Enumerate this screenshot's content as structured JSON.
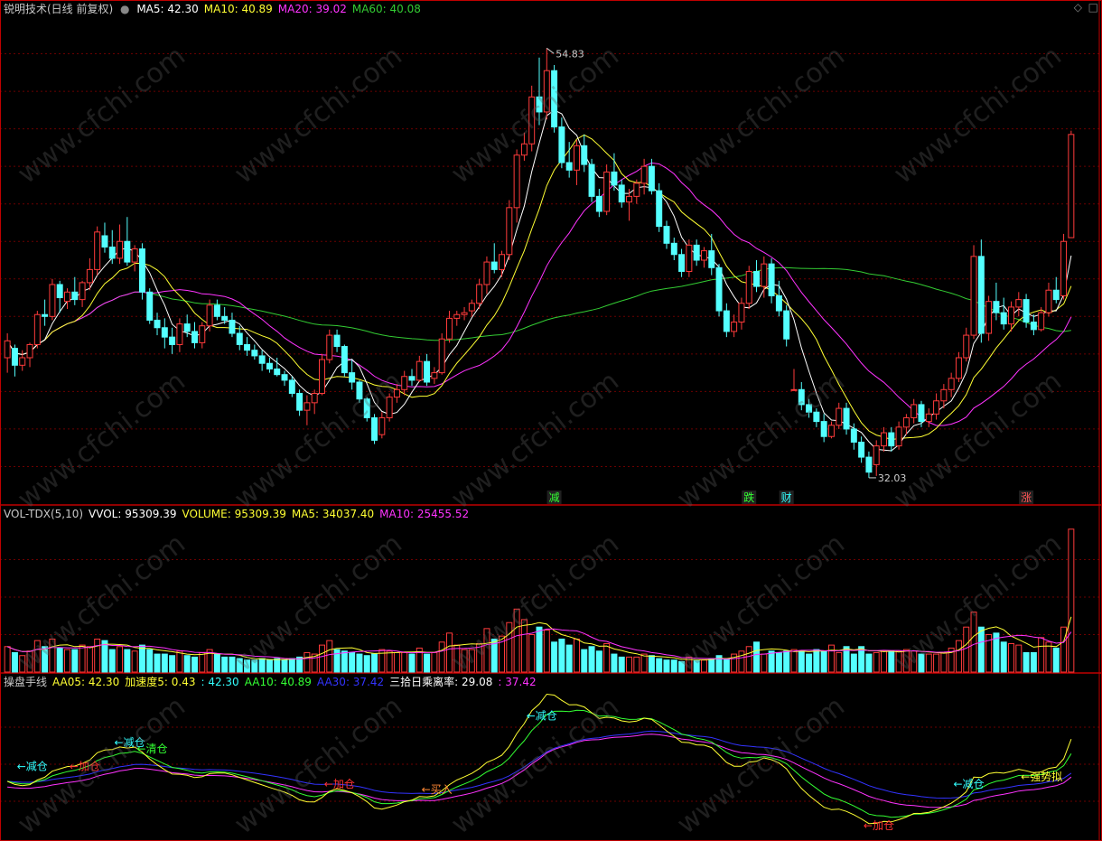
{
  "title": "锐明技术(日线 前复权)",
  "colors": {
    "up": "#ff3b3b",
    "down": "#54ffff",
    "ma5": "#ffffff",
    "ma10": "#ffff33",
    "ma20": "#ff33ff",
    "ma60": "#33cc33",
    "grid": "#6b0000",
    "border": "#c00000"
  },
  "main_header": [
    {
      "text": "MA5: 42.30",
      "color": "#ffffff"
    },
    {
      "text": "MA10: 40.89",
      "color": "#ffff33"
    },
    {
      "text": "MA20: 39.02",
      "color": "#ff33ff"
    },
    {
      "text": "MA60: 40.08",
      "color": "#33cc33"
    }
  ],
  "vol_header": [
    {
      "text": "VOL-TDX(5,10)",
      "color": "#c8c8c8"
    },
    {
      "text": "VVOL: 95309.39",
      "color": "#ffffff"
    },
    {
      "text": "VOLUME: 95309.39",
      "color": "#ffff33"
    },
    {
      "text": "MA5: 34037.40",
      "color": "#ffff33"
    },
    {
      "text": "MA10: 25455.52",
      "color": "#ff33ff"
    }
  ],
  "ind_header": [
    {
      "text": "操盘手线",
      "color": "#c8c8c8"
    },
    {
      "text": "AA05: 42.30",
      "color": "#ffff33"
    },
    {
      "text": "加速度5: 0.43",
      "color": "#ffff33"
    },
    {
      "text": ": 42.30",
      "color": "#33ffff"
    },
    {
      "text": "AA10: 40.89",
      "color": "#33ff33"
    },
    {
      "text": "AA30: 37.42",
      "color": "#3333ff"
    },
    {
      "text": "三拾日乘离率: 29.08",
      "color": "#ffffff"
    },
    {
      "text": ": 37.42",
      "color": "#ff33ff"
    }
  ],
  "price_labels": {
    "high": "54.83",
    "low": "32.03"
  },
  "markers": [
    {
      "text": "减",
      "color": "#33ff33",
      "bar": 73
    },
    {
      "text": "跌",
      "color": "#33ff33",
      "bar": 99
    },
    {
      "text": "财",
      "color": "#33ffff",
      "bar": 104
    },
    {
      "text": "涨",
      "color": "#ff5555",
      "bar": 136
    }
  ],
  "ind_labels": [
    {
      "text": "←减仓",
      "color": "#33ffff",
      "bar": 2,
      "val": 41.2
    },
    {
      "text": "←加仓",
      "color": "#ff3333",
      "bar": 9,
      "val": 41.2
    },
    {
      "text": "←减仓",
      "color": "#33ffff",
      "bar": 15,
      "val": 44.4
    },
    {
      "text": "←清仓",
      "color": "#33ff33",
      "bar": 18,
      "val": 43.6
    },
    {
      "text": "←加仓",
      "color": "#ff3333",
      "bar": 43,
      "val": 38.8
    },
    {
      "text": "←买入",
      "color": "#ff8833",
      "bar": 56,
      "val": 38.1
    },
    {
      "text": "←减仓",
      "color": "#33ffff",
      "bar": 70,
      "val": 48.0
    },
    {
      "text": "←加仓",
      "color": "#ff3333",
      "bar": 115,
      "val": 33.2
    },
    {
      "text": "←减仓",
      "color": "#33ffff",
      "bar": 127,
      "val": 38.8
    },
    {
      "text": "←强势拟",
      "color": "#ffff33",
      "bar": 136,
      "val": 39.8
    }
  ],
  "watermark": "www.cfchi.com",
  "chart_data": {
    "type": "candlestick",
    "ylim": [
      30.5,
      56.5
    ],
    "vol_ylim": [
      0,
      100000
    ],
    "ind_ylim": [
      31.5,
      51.5
    ],
    "ohlc": [
      [
        38.3,
        39.6,
        37.5,
        39.2
      ],
      [
        38.8,
        39.0,
        37.3,
        37.9
      ],
      [
        37.9,
        38.7,
        37.6,
        38.3
      ],
      [
        38.3,
        39.1,
        37.8,
        39.0
      ],
      [
        39.0,
        40.8,
        38.8,
        40.6
      ],
      [
        40.6,
        41.4,
        40.0,
        40.5
      ],
      [
        40.5,
        42.5,
        40.3,
        42.2
      ],
      [
        42.2,
        42.4,
        40.7,
        41.5
      ],
      [
        41.3,
        42.0,
        40.9,
        41.8
      ],
      [
        41.8,
        42.6,
        41.1,
        41.4
      ],
      [
        41.4,
        42.4,
        41.0,
        42.3
      ],
      [
        42.3,
        43.6,
        41.9,
        43.0
      ],
      [
        43.0,
        45.3,
        42.7,
        45.0
      ],
      [
        44.8,
        45.5,
        43.9,
        44.2
      ],
      [
        44.2,
        45.1,
        43.3,
        43.6
      ],
      [
        43.6,
        45.4,
        43.3,
        44.5
      ],
      [
        44.5,
        45.8,
        43.2,
        43.4
      ],
      [
        43.4,
        44.3,
        42.9,
        44.1
      ],
      [
        44.1,
        44.4,
        41.4,
        41.8
      ],
      [
        41.8,
        42.0,
        40.1,
        40.3
      ],
      [
        40.3,
        40.7,
        39.5,
        39.9
      ],
      [
        39.9,
        40.4,
        38.8,
        39.4
      ],
      [
        39.4,
        39.9,
        38.5,
        39.0
      ],
      [
        39.0,
        40.4,
        38.6,
        40.1
      ],
      [
        40.1,
        40.6,
        39.4,
        39.7
      ],
      [
        39.7,
        40.2,
        38.8,
        39.1
      ],
      [
        39.1,
        40.2,
        38.8,
        40.0
      ],
      [
        40.0,
        41.4,
        39.7,
        41.1
      ],
      [
        41.1,
        41.4,
        40.3,
        40.5
      ],
      [
        40.5,
        41.0,
        40.1,
        40.3
      ],
      [
        40.3,
        40.7,
        39.4,
        39.6
      ],
      [
        39.6,
        40.0,
        38.7,
        39.0
      ],
      [
        39.0,
        39.4,
        38.4,
        38.7
      ],
      [
        38.7,
        39.0,
        38.2,
        38.4
      ],
      [
        38.4,
        38.7,
        37.6,
        38.0
      ],
      [
        38.0,
        38.3,
        37.5,
        37.7
      ],
      [
        37.7,
        38.3,
        37.3,
        37.4
      ],
      [
        37.4,
        37.6,
        36.8,
        37.1
      ],
      [
        37.1,
        37.3,
        36.2,
        36.4
      ],
      [
        36.4,
        36.6,
        35.2,
        35.5
      ],
      [
        35.5,
        36.3,
        34.7,
        35.9
      ],
      [
        35.9,
        36.6,
        35.3,
        36.4
      ],
      [
        36.4,
        38.5,
        36.3,
        38.2
      ],
      [
        38.2,
        39.8,
        38.0,
        39.5
      ],
      [
        39.5,
        39.8,
        38.6,
        38.9
      ],
      [
        38.9,
        39.0,
        37.3,
        37.5
      ],
      [
        37.5,
        38.2,
        36.6,
        37.0
      ],
      [
        37.0,
        37.1,
        35.9,
        36.1
      ],
      [
        36.1,
        36.2,
        34.9,
        35.1
      ],
      [
        35.1,
        35.3,
        33.7,
        33.9
      ],
      [
        34.2,
        35.4,
        34.0,
        35.1
      ],
      [
        35.1,
        36.4,
        34.9,
        36.2
      ],
      [
        36.2,
        36.9,
        35.9,
        36.6
      ],
      [
        36.6,
        37.6,
        36.3,
        37.3
      ],
      [
        37.3,
        37.7,
        36.8,
        37.1
      ],
      [
        37.1,
        38.4,
        37.0,
        38.1
      ],
      [
        38.1,
        38.5,
        36.8,
        37.0
      ],
      [
        37.2,
        37.8,
        36.9,
        37.5
      ],
      [
        37.5,
        39.6,
        37.4,
        39.3
      ],
      [
        39.3,
        40.8,
        39.1,
        40.4
      ],
      [
        40.4,
        40.8,
        40.0,
        40.6
      ],
      [
        40.6,
        41.0,
        40.3,
        40.7
      ],
      [
        40.8,
        41.4,
        40.5,
        41.2
      ],
      [
        41.2,
        42.5,
        40.9,
        42.2
      ],
      [
        42.2,
        43.7,
        41.7,
        43.4
      ],
      [
        43.4,
        44.4,
        42.8,
        43.0
      ],
      [
        43.0,
        44.0,
        42.6,
        43.8
      ],
      [
        43.8,
        46.7,
        43.5,
        46.3
      ],
      [
        46.3,
        49.4,
        45.5,
        49.1
      ],
      [
        49.1,
        50.3,
        48.8,
        49.7
      ],
      [
        49.7,
        52.8,
        49.3,
        52.2
      ],
      [
        52.2,
        54.3,
        50.7,
        51.4
      ],
      [
        51.4,
        54.8,
        51.0,
        53.6
      ],
      [
        53.6,
        53.9,
        50.3,
        50.6
      ],
      [
        50.6,
        51.1,
        48.4,
        48.7
      ],
      [
        48.7,
        49.8,
        47.9,
        48.3
      ],
      [
        48.3,
        49.9,
        47.5,
        49.6
      ],
      [
        49.6,
        50.2,
        48.2,
        48.6
      ],
      [
        48.6,
        48.9,
        46.6,
        46.9
      ],
      [
        46.9,
        47.3,
        45.8,
        46.1
      ],
      [
        46.1,
        48.6,
        45.9,
        48.2
      ],
      [
        48.2,
        49.2,
        47.2,
        47.5
      ],
      [
        47.5,
        47.8,
        46.3,
        46.6
      ],
      [
        46.6,
        47.3,
        45.6,
        46.9
      ],
      [
        46.9,
        47.8,
        46.5,
        47.6
      ],
      [
        47.6,
        48.9,
        47.0,
        48.5
      ],
      [
        48.5,
        48.9,
        47.0,
        47.2
      ],
      [
        47.2,
        47.6,
        45.0,
        45.3
      ],
      [
        45.3,
        45.6,
        44.1,
        44.4
      ],
      [
        44.4,
        44.7,
        43.5,
        43.8
      ],
      [
        43.8,
        44.1,
        42.6,
        42.9
      ],
      [
        42.9,
        44.6,
        42.6,
        44.3
      ],
      [
        44.3,
        44.6,
        43.2,
        43.5
      ],
      [
        43.5,
        44.2,
        43.1,
        44.0
      ],
      [
        44.0,
        44.9,
        42.7,
        43.1
      ],
      [
        43.1,
        43.3,
        40.5,
        40.8
      ],
      [
        40.8,
        41.2,
        39.4,
        39.7
      ],
      [
        39.7,
        40.6,
        39.4,
        40.2
      ],
      [
        40.2,
        41.5,
        39.8,
        41.2
      ],
      [
        41.2,
        43.2,
        40.9,
        42.9
      ],
      [
        42.9,
        43.5,
        41.8,
        42.1
      ],
      [
        42.1,
        43.7,
        41.5,
        43.3
      ],
      [
        43.3,
        43.6,
        41.2,
        41.6
      ],
      [
        41.6,
        42.4,
        40.5,
        40.8
      ],
      [
        40.8,
        41.1,
        38.9,
        39.3
      ],
      [
        36.6,
        37.7,
        36.6,
        36.6
      ],
      [
        36.6,
        37.0,
        35.5,
        35.8
      ],
      [
        35.8,
        36.1,
        35.1,
        35.4
      ],
      [
        35.4,
        35.6,
        34.6,
        34.9
      ],
      [
        34.9,
        35.3,
        33.8,
        34.1
      ],
      [
        34.1,
        34.9,
        34.0,
        34.7
      ],
      [
        34.7,
        35.9,
        34.5,
        35.6
      ],
      [
        35.6,
        35.9,
        34.2,
        34.5
      ],
      [
        34.5,
        34.8,
        33.4,
        33.8
      ],
      [
        33.8,
        34.1,
        32.7,
        33.0
      ],
      [
        33.0,
        33.3,
        31.9,
        32.2
      ],
      [
        32.6,
        33.9,
        32.0,
        33.6
      ],
      [
        33.6,
        34.6,
        33.3,
        34.3
      ],
      [
        34.3,
        34.6,
        33.3,
        33.6
      ],
      [
        33.6,
        34.9,
        33.4,
        34.6
      ],
      [
        34.6,
        35.3,
        34.2,
        35.1
      ],
      [
        35.1,
        36.1,
        34.8,
        35.8
      ],
      [
        35.8,
        36.0,
        34.6,
        34.9
      ],
      [
        34.9,
        35.6,
        34.6,
        35.3
      ],
      [
        35.3,
        36.4,
        35.0,
        36.0
      ],
      [
        36.0,
        36.9,
        35.6,
        36.6
      ],
      [
        36.6,
        37.5,
        36.2,
        37.2
      ],
      [
        37.2,
        38.6,
        37.0,
        38.3
      ],
      [
        38.3,
        39.9,
        38.1,
        39.5
      ],
      [
        39.5,
        44.3,
        39.3,
        43.7
      ],
      [
        43.7,
        44.6,
        39.1,
        39.6
      ],
      [
        39.6,
        41.6,
        39.2,
        41.3
      ],
      [
        41.3,
        42.3,
        40.3,
        40.7
      ],
      [
        40.7,
        41.5,
        39.8,
        40.1
      ],
      [
        40.1,
        41.3,
        39.7,
        41.0
      ],
      [
        41.0,
        41.8,
        40.5,
        41.4
      ],
      [
        41.4,
        41.7,
        39.9,
        40.2
      ],
      [
        40.2,
        40.6,
        39.5,
        39.8
      ],
      [
        39.8,
        41.0,
        39.7,
        40.7
      ],
      [
        40.7,
        42.3,
        40.5,
        41.9
      ],
      [
        41.9,
        42.6,
        41.2,
        41.4
      ],
      [
        41.6,
        44.9,
        41.4,
        44.5
      ],
      [
        44.7,
        50.4,
        44.7,
        50.2
      ]
    ],
    "volume": [
      17000,
      13000,
      11000,
      14000,
      21000,
      17000,
      22000,
      16000,
      15000,
      15000,
      18000,
      17000,
      22000,
      21000,
      15000,
      17000,
      15000,
      14000,
      18000,
      15000,
      12000,
      12000,
      11000,
      14000,
      11000,
      10000,
      13000,
      15000,
      12000,
      10000,
      10000,
      9000,
      8000,
      8000,
      9000,
      8000,
      9000,
      8000,
      9000,
      10000,
      13000,
      12000,
      18000,
      21000,
      15000,
      14000,
      13000,
      12000,
      11000,
      12000,
      15000,
      14000,
      13000,
      13000,
      12000,
      16000,
      12000,
      13000,
      20000,
      26000,
      18000,
      15000,
      15000,
      19000,
      29000,
      22000,
      24000,
      33000,
      42000,
      35000,
      25000,
      30000,
      28000,
      20000,
      22000,
      18000,
      22000,
      15000,
      17000,
      14000,
      19000,
      12000,
      10000,
      10000,
      10000,
      12000,
      11000,
      9000,
      8000,
      8000,
      7000,
      10000,
      8000,
      8000,
      9000,
      11000,
      9000,
      12000,
      14000,
      17000,
      20000,
      12000,
      14000,
      13000,
      14000,
      15000,
      14000,
      12000,
      15000,
      14000,
      18000,
      13000,
      17000,
      12000,
      17000,
      12000,
      13000,
      14000,
      14000,
      14000,
      15000,
      14000,
      12000,
      12000,
      12000,
      13000,
      16000,
      21000,
      30000,
      40000,
      30000,
      25000,
      26000,
      20000,
      19000,
      18000,
      13000,
      13000,
      23000,
      20000,
      16000,
      30000,
      95309
    ],
    "ma": {
      "periods": [
        5,
        10,
        20,
        60
      ]
    },
    "indicator_lines": [
      "AA05",
      "AA10",
      "AA30",
      "三拾日乘离率"
    ]
  }
}
